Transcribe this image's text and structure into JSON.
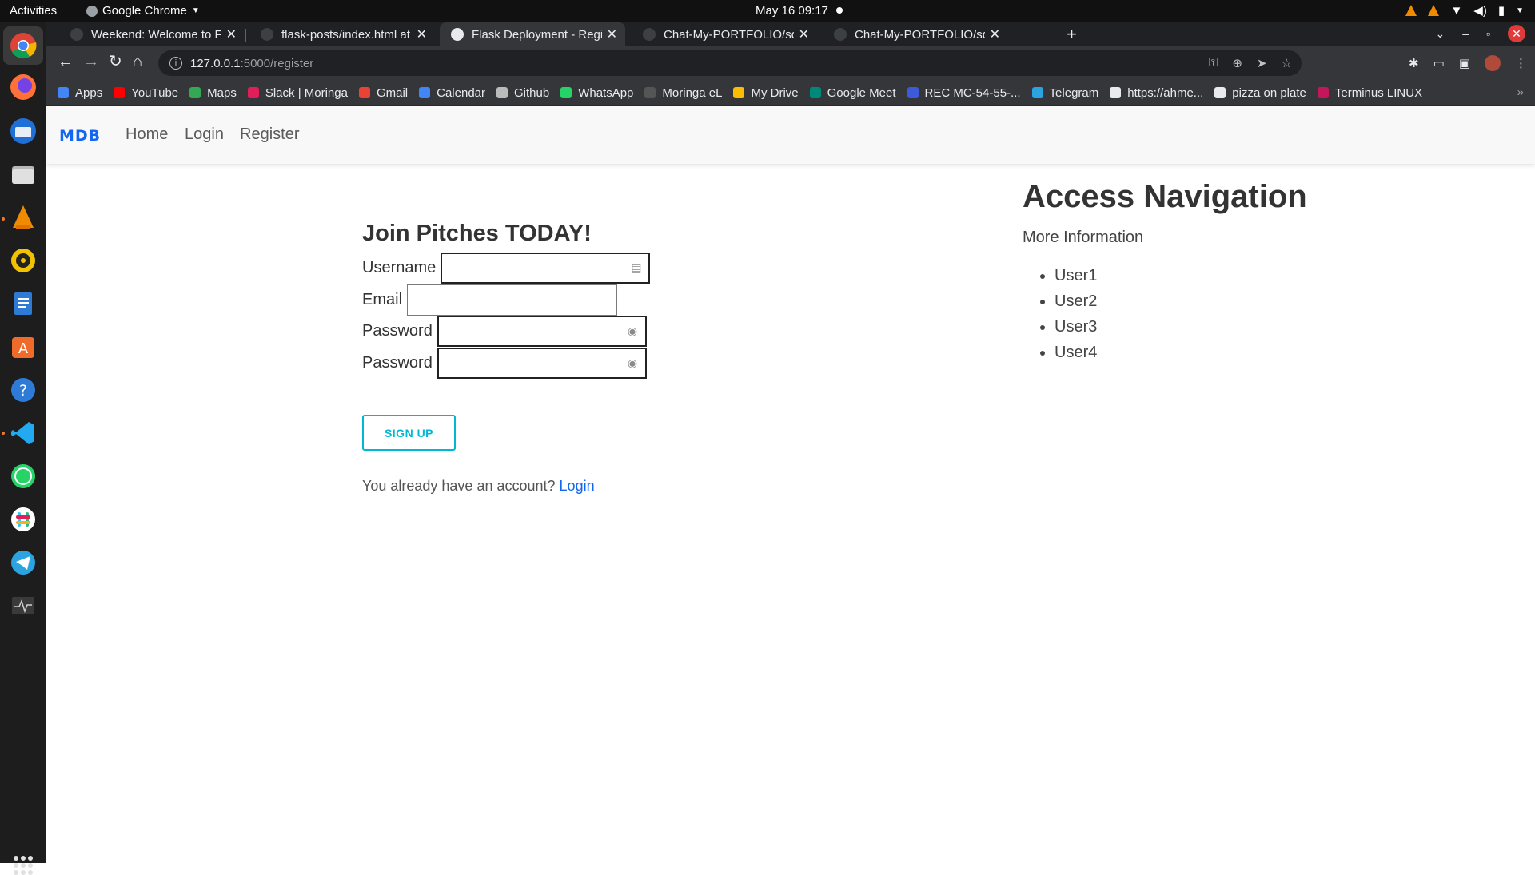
{
  "os": {
    "activities": "Activities",
    "app_name": "Google Chrome",
    "clock": "May 16  09:17"
  },
  "tabs": [
    {
      "title": "Weekend: Welcome to Fla",
      "active": false
    },
    {
      "title": "flask-posts/index.html at",
      "active": false
    },
    {
      "title": "Flask Deployment - Regist",
      "active": true
    },
    {
      "title": "Chat-My-PORTFOLIO/squ",
      "active": false
    },
    {
      "title": "Chat-My-PORTFOLIO/squ",
      "active": false
    }
  ],
  "address": {
    "host": "127.0.0.1",
    "path": ":5000/register"
  },
  "bookmarks": [
    {
      "label": "Apps",
      "color": "#4285f4"
    },
    {
      "label": "YouTube",
      "color": "#ff0000"
    },
    {
      "label": "Maps",
      "color": "#34a853"
    },
    {
      "label": "Slack | Moringa",
      "color": "#e01e5a"
    },
    {
      "label": "Gmail",
      "color": "#ea4335"
    },
    {
      "label": "Calendar",
      "color": "#4285f4"
    },
    {
      "label": "Github",
      "color": "#bbbbbb"
    },
    {
      "label": "WhatsApp",
      "color": "#25d366"
    },
    {
      "label": "Moringa eL",
      "color": "#555555"
    },
    {
      "label": "My Drive",
      "color": "#fbbc04"
    },
    {
      "label": "Google Meet",
      "color": "#00897b"
    },
    {
      "label": "REC MC-54-55-...",
      "color": "#3b5bdb"
    },
    {
      "label": "Telegram",
      "color": "#2aa3e0"
    },
    {
      "label": "https://ahme...",
      "color": "#e8eaed"
    },
    {
      "label": "pizza on plate",
      "color": "#e8eaed"
    },
    {
      "label": "Terminus LINUX",
      "color": "#c2185b"
    }
  ],
  "site": {
    "brand": "MDB",
    "nav": [
      "Home",
      "Login",
      "Register"
    ]
  },
  "form": {
    "title": "Join Pitches TODAY!",
    "username_label": "Username",
    "email_label": "Email",
    "password_label": "Password",
    "confirm_label": "Password",
    "username_value": "",
    "email_value": "",
    "password_value": "",
    "confirm_value": "",
    "submit_label": "SIGN UP",
    "already_text": "You already have an account?",
    "login_link": "Login"
  },
  "side": {
    "heading": "Access Navigation",
    "subheading": "More Information",
    "users": [
      "User1",
      "User2",
      "User3",
      "User4"
    ]
  },
  "colors": {
    "brand": "#1266f1",
    "signup": "#00b7d4"
  }
}
